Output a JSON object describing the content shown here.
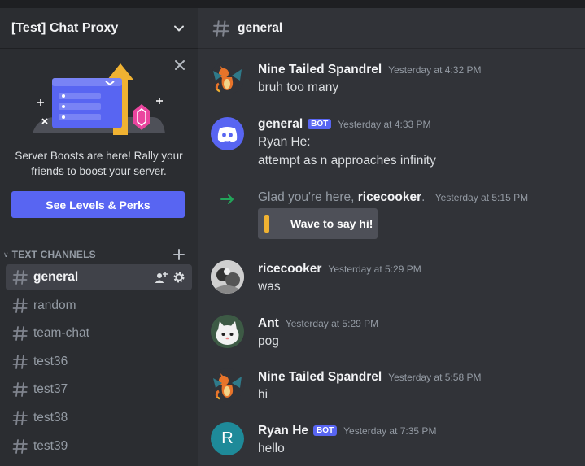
{
  "server": {
    "name": "[Test] Chat Proxy",
    "menu_icon": "chevron-down-icon"
  },
  "boost": {
    "text": "Server Boosts are here! Rally your friends to boost your server.",
    "button_label": "See Levels & Perks",
    "close_icon": "close-icon"
  },
  "category": {
    "label": "TEXT CHANNELS"
  },
  "channels": [
    {
      "name": "general",
      "active": true
    },
    {
      "name": "random"
    },
    {
      "name": "team-chat"
    },
    {
      "name": "test36"
    },
    {
      "name": "test37"
    },
    {
      "name": "test38"
    },
    {
      "name": "test39"
    }
  ],
  "header": {
    "channel": "general"
  },
  "messages": [
    {
      "author": "Nine Tailed Spandrel",
      "timestamp": "Yesterday at 4:32 PM",
      "lines": [
        "bruh too many"
      ],
      "avatar": "dragon"
    },
    {
      "author": "general",
      "bot_tag": "BOT",
      "timestamp": "Yesterday at 4:33 PM",
      "lines": [
        "Ryan He:",
        "attempt as n approaches infinity"
      ],
      "avatar": "discord"
    },
    {
      "author": "ricecooker",
      "timestamp": "Yesterday at 5:29 PM",
      "lines": [
        "was"
      ],
      "avatar": "photo"
    },
    {
      "author": "Ant",
      "timestamp": "Yesterday at 5:29 PM",
      "lines": [
        "pog"
      ],
      "avatar": "cat"
    },
    {
      "author": "Nine Tailed Spandrel",
      "timestamp": "Yesterday at 5:58 PM",
      "lines": [
        "hi"
      ],
      "avatar": "dragon"
    },
    {
      "author": "Ryan He",
      "bot_tag": "BOT",
      "timestamp": "Yesterday at 7:35 PM",
      "lines": [
        "hello"
      ],
      "avatar": "letter",
      "avatar_letter": "R"
    }
  ],
  "join": {
    "prefix": "Glad you're here,",
    "user": "ricecooker",
    "suffix": ".",
    "timestamp": "Yesterday at 5:15 PM",
    "wave_label": "Wave to say hi!"
  },
  "colors": {
    "accent": "#5865f2",
    "sidebar": "#2b2d31",
    "main": "#313338",
    "join_arrow": "#23a55a"
  }
}
